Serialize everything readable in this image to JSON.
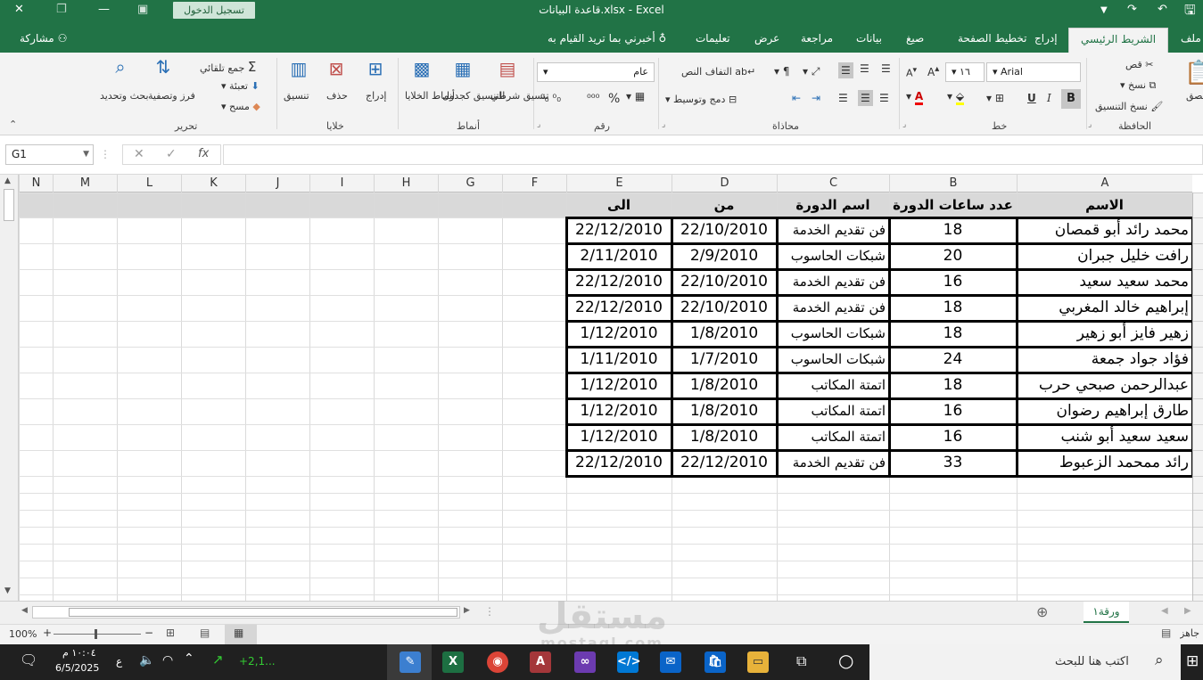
{
  "titlebar": {
    "document": "قاعدة البيانات.xlsx  -  Excel",
    "login_label": "تسجيل الدخول"
  },
  "ribbon_tabs": {
    "file": "ملف",
    "home": "الشريط الرئيسي",
    "insert": "إدراج",
    "page_layout": "تخطيط الصفحة",
    "formulas": "صيغ",
    "data": "بيانات",
    "review": "مراجعة",
    "view": "عرض",
    "help": "تعليمات",
    "tell_me": "أخبرني بما تريد القيام به",
    "share": "مشاركة"
  },
  "ribbon": {
    "clipboard": {
      "group": "الحافظة",
      "cut": "قص",
      "copy": "نسخ",
      "format_painter": "نسخ التنسيق",
      "paste": "لصق"
    },
    "font": {
      "group": "خط",
      "font_name": "Arial",
      "font_size": "١٦",
      "bold": "B",
      "italic": "I",
      "underline": "U"
    },
    "alignment": {
      "group": "محاذاة",
      "wrap_text": "التفاف النص",
      "merge_center": "دمج وتوسيط"
    },
    "number": {
      "group": "رقم",
      "format": "عام",
      "percent": "%"
    },
    "styles": {
      "group": "أنماط",
      "conditional": "تنسيق شرطي",
      "as_table": "التنسيق كجدول",
      "cell_styles": "أنماط الخلايا"
    },
    "cells": {
      "group": "خلايا",
      "insert": "إدراج",
      "delete": "حذف",
      "format": "تنسيق"
    },
    "editing": {
      "group": "تحرير",
      "autosum": "جمع تلقائي",
      "fill": "تعبئة",
      "clear": "مسح",
      "sort_filter": "فرز وتصفية",
      "find_select": "بحث وتحديد"
    }
  },
  "formula_bar": {
    "name_box": "G1",
    "fx": "fx",
    "cancel": "✕",
    "enter": "✓",
    "value": ""
  },
  "columns": [
    "A",
    "B",
    "C",
    "D",
    "E",
    "F",
    "G",
    "H",
    "I",
    "J",
    "K",
    "L",
    "M",
    "N"
  ],
  "table": {
    "headers": [
      "الاسم",
      "عدد ساعات الدورة",
      "اسم الدورة",
      "من",
      "الى"
    ],
    "rows": [
      [
        "محمد رائد أبو قمصان",
        "18",
        "فن تقديم الخدمة",
        "22/10/2010",
        "22/12/2010"
      ],
      [
        "رافت خليل جبران",
        "20",
        "شبكات الحاسوب",
        "2/9/2010",
        "2/11/2010"
      ],
      [
        "محمد سعيد سعيد",
        "16",
        "فن تقديم الخدمة",
        "22/10/2010",
        "22/12/2010"
      ],
      [
        "إبراهيم خالد المغربي",
        "18",
        "فن تقديم الخدمة",
        "22/10/2010",
        "22/12/2010"
      ],
      [
        "زهير فايز أبو زهير",
        "18",
        "شبكات الحاسوب",
        "1/8/2010",
        "1/12/2010"
      ],
      [
        "فؤاد جواد جمعة",
        "24",
        "شبكات الحاسوب",
        "1/7/2010",
        "1/11/2010"
      ],
      [
        "عبدالرحمن صبحي حرب",
        "18",
        "اتمتة المكاتب",
        "1/8/2010",
        "1/12/2010"
      ],
      [
        "طارق إبراهيم رضوان",
        "16",
        "اتمتة المكاتب",
        "1/8/2010",
        "1/12/2010"
      ],
      [
        "سعيد سعيد أبو شنب",
        "16",
        "اتمتة المكاتب",
        "1/8/2010",
        "1/12/2010"
      ],
      [
        "رائد ممحمد الزعبوط",
        "33",
        "فن تقديم الخدمة",
        "22/12/2010",
        "22/12/2010"
      ]
    ]
  },
  "sheet_tabs": [
    "ورقة١"
  ],
  "status": {
    "ready": "جاهز",
    "zoom": "100%"
  },
  "taskbar": {
    "search_placeholder": "اكتب هنا للبحث",
    "time": "١٠:٠٤ م",
    "date": "6/5/2025",
    "lang": "ع",
    "stock": "+2,1..."
  },
  "watermark": {
    "text": "مستقل",
    "sub": "mostaql.com"
  },
  "colors": {
    "excel_green": "#217346",
    "taskbar": "#202020"
  }
}
